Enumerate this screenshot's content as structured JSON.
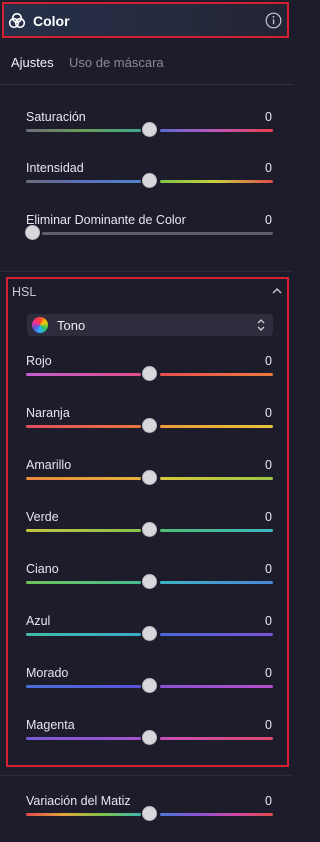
{
  "header": {
    "title": "Color"
  },
  "tabs": [
    {
      "label": "Ajustes",
      "active": true
    },
    {
      "label": "Uso de máscara",
      "active": false
    }
  ],
  "adjust_sliders": [
    {
      "label": "Saturación",
      "value": "0"
    },
    {
      "label": "Intensidad",
      "value": "0"
    },
    {
      "label": "Eliminar Dominante de Color",
      "value": "0"
    }
  ],
  "hsl": {
    "title": "HSL",
    "mode": "Tono",
    "sliders": [
      {
        "label": "Rojo",
        "value": "0"
      },
      {
        "label": "Naranja",
        "value": "0"
      },
      {
        "label": "Amarillo",
        "value": "0"
      },
      {
        "label": "Verde",
        "value": "0"
      },
      {
        "label": "Ciano",
        "value": "0"
      },
      {
        "label": "Azul",
        "value": "0"
      },
      {
        "label": "Morado",
        "value": "0"
      },
      {
        "label": "Magenta",
        "value": "0"
      }
    ]
  },
  "bottom_slider": {
    "label": "Variación del Matiz",
    "value": "0"
  },
  "colors": {
    "accent_outline": "#d42030",
    "background": "#1d1c2b"
  }
}
